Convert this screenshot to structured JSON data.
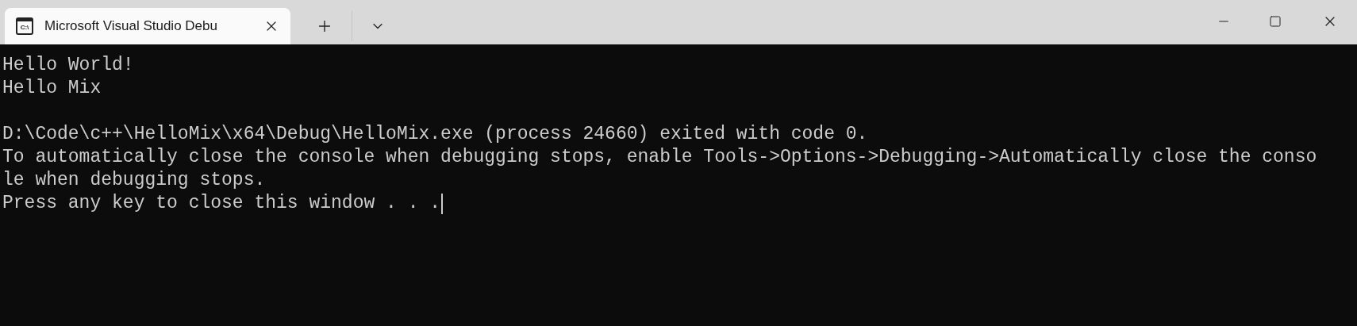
{
  "tabs": [
    {
      "title": "Microsoft Visual Studio Debu",
      "selected": true,
      "icon_text": "C:\\"
    }
  ],
  "console": {
    "blocks": [
      [
        "Hello World!",
        "Hello Mix"
      ],
      [
        "D:\\Code\\c++\\HelloMix\\x64\\Debug\\HelloMix.exe (process 24660) exited with code 0.",
        "To automatically close the console when debugging stops, enable Tools->Options->Debugging->Automatically close the conso",
        "le when debugging stops.",
        "Press any key to close this window . . ."
      ]
    ]
  }
}
